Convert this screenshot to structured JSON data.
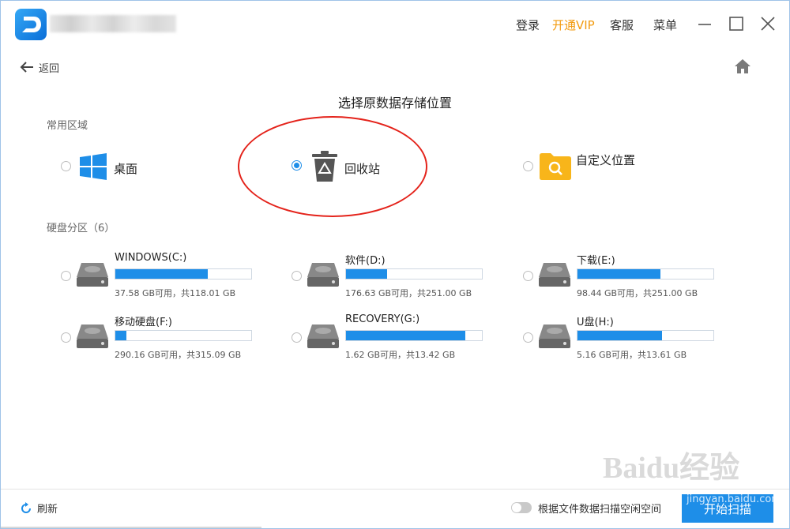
{
  "titlebar": {
    "login": "登录",
    "vip": "开通VIP",
    "service": "客服",
    "menu": "菜单"
  },
  "nav": {
    "back_label": "返回"
  },
  "page": {
    "title": "选择原数据存储位置",
    "common_section": "常用区域",
    "disk_section": "硬盘分区（6）"
  },
  "locations": [
    {
      "label": "桌面",
      "icon": "windows-icon",
      "selected": false
    },
    {
      "label": "回收站",
      "icon": "recycle-bin-icon",
      "selected": true
    },
    {
      "label": "自定义位置",
      "icon": "folder-search-icon",
      "selected": false
    }
  ],
  "drives": [
    {
      "name": "WINDOWS(C:)",
      "info": "37.58 GB可用，共118.01 GB",
      "used_fraction": 0.68
    },
    {
      "name": "软件(D:)",
      "info": "176.63 GB可用，共251.00 GB",
      "used_fraction": 0.3
    },
    {
      "name": "下载(E:)",
      "info": "98.44 GB可用，共251.00 GB",
      "used_fraction": 0.61
    },
    {
      "name": "移动硬盘(F:)",
      "info": "290.16 GB可用，共315.09 GB",
      "used_fraction": 0.08
    },
    {
      "name": "RECOVERY(G:)",
      "info": "1.62 GB可用，共13.42 GB",
      "used_fraction": 0.88
    },
    {
      "name": "U盘(H:)",
      "info": "5.16 GB可用，共13.61 GB",
      "used_fraction": 0.62
    }
  ],
  "footer": {
    "refresh_label": "刷新",
    "toggle_label": "根据文件数据扫描空闲空间",
    "start_label": "开始扫描"
  },
  "watermark": {
    "brand": "Baidu经验",
    "url": "jingyan.baidu.com"
  },
  "colors": {
    "accent": "#1e8ee8",
    "vip": "#f29b10",
    "highlight": "#e4231b"
  }
}
